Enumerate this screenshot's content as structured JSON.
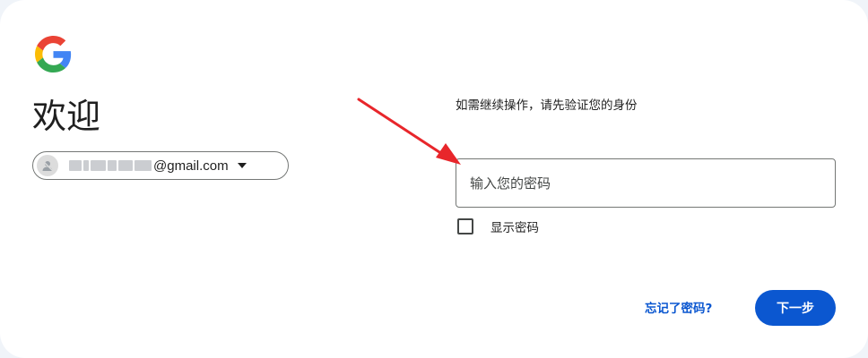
{
  "header": {
    "logo_icon": "google-g-logo",
    "title": "欢迎"
  },
  "account": {
    "email_visible": "@gmail.com",
    "avatar_icon": "default-avatar-icon",
    "dropdown_icon": "caret-down-icon"
  },
  "main": {
    "instruction": "如需继续操作，请先验证您的身份",
    "password_placeholder": "输入您的密码",
    "password_value": "",
    "show_password_label": "显示密码",
    "show_password_checked": false
  },
  "footer": {
    "forgot_label": "忘记了密码?",
    "next_label": "下一步"
  },
  "colors": {
    "primary": "#0b57d0",
    "annotation_arrow": "#e8262b"
  }
}
